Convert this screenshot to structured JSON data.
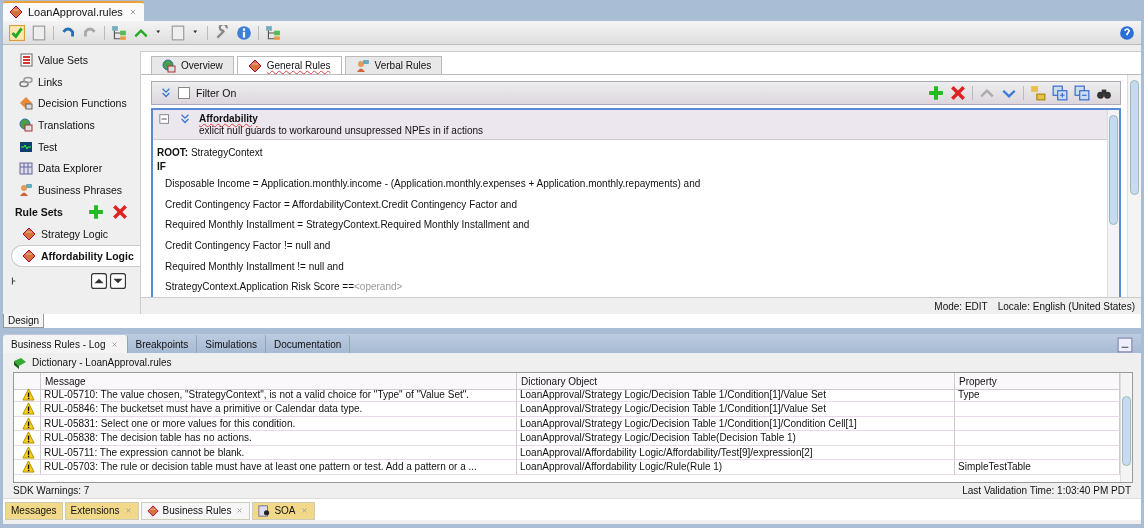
{
  "editor_tab": {
    "title": "LoanApproval.rules",
    "selected": true
  },
  "sidebar": {
    "items": [
      {
        "label": "Value Sets"
      },
      {
        "label": "Links"
      },
      {
        "label": "Decision Functions"
      },
      {
        "label": "Translations"
      },
      {
        "label": "Test"
      },
      {
        "label": "Data Explorer"
      },
      {
        "label": "Business Phrases"
      }
    ],
    "rule_sets_heading": "Rule Sets",
    "rule_sets": [
      {
        "label": "Strategy Logic",
        "selected": false
      },
      {
        "label": "Affordability Logic",
        "selected": true
      }
    ]
  },
  "content_tabs": [
    {
      "label": "Overview",
      "selected": false
    },
    {
      "label": "General Rules",
      "selected": true
    },
    {
      "label": "Verbal Rules",
      "selected": false
    }
  ],
  "filter": {
    "label": "Filter On",
    "checked": false
  },
  "rule": {
    "name": "Affordability",
    "description": "exlicit null guards to workaround unsupressed NPEs in if actions",
    "expanded": true,
    "root_label": "ROOT:",
    "root": "StrategyContext",
    "if_label": "IF",
    "conditions": [
      {
        "text": "Disposable Income = Application.monthly.income - (Application.monthly.expenses + Application.monthly.repayments) and"
      },
      {
        "text": "Credit Contingency Factor = AffordabilityContext.Credit Contingency Factor and"
      },
      {
        "text": "Required Monthly Installment = StrategyContext.Required Monthly Installment and"
      },
      {
        "text": "Credit Contingency Factor  !=  null and"
      },
      {
        "text": "Required Monthly Installment  !=  null and"
      },
      {
        "text": "StrategyContext.Application Risk Score  ==  ",
        "operand": "<operand>"
      }
    ]
  },
  "status": {
    "mode": "Mode: EDIT",
    "locale": "Locale: English (United States)"
  },
  "design_tab": {
    "label": "Design",
    "selected": true
  },
  "log_tabs": [
    {
      "label": "Business Rules - Log",
      "selected": true
    },
    {
      "label": "Breakpoints",
      "selected": false
    },
    {
      "label": "Simulations",
      "selected": false
    },
    {
      "label": "Documentation",
      "selected": false
    }
  ],
  "dictionary": "Dictionary - LoanApproval.rules",
  "log_table": {
    "columns": [
      "Message",
      "Dictionary Object",
      "Property"
    ],
    "rows": [
      {
        "message": "RUL-05710: The value chosen, \"StrategyContext\", is not a valid choice for \"Type\" of \"Value Set\".",
        "object": "LoanApproval/Strategy Logic/Decision Table 1/Condition[1]/Value Set",
        "property": "Type"
      },
      {
        "message": "RUL-05846: The bucketset must have a primitive or Calendar data type.",
        "object": "LoanApproval/Strategy Logic/Decision Table 1/Condition[1]/Value Set",
        "property": ""
      },
      {
        "message": "RUL-05831: Select one or more values for this condition.",
        "object": "LoanApproval/Strategy Logic/Decision Table 1/Condition[1]/Condition Cell[1]",
        "property": ""
      },
      {
        "message": "RUL-05838: The decision table has no actions.",
        "object": "LoanApproval/Strategy Logic/Decision Table(Decision Table 1)",
        "property": ""
      },
      {
        "message": "RUL-05711: The expression cannot be blank.",
        "object": "LoanApproval/Affordability Logic/Affordability/Test[9]/expression[2]",
        "property": ""
      },
      {
        "message": "RUL-05703: The rule or decision table must have at least one pattern or test.  Add a pattern or a ...",
        "object": "LoanApproval/Affordability Logic/Rule(Rule 1)",
        "property": "SimpleTestTable"
      }
    ]
  },
  "sdk_warnings": "SDK Warnings: 7",
  "last_validation": "Last Validation Time: 1:03:40 PM PDT",
  "window_tabs": [
    {
      "label": "Messages",
      "kind": "plain",
      "selected": false
    },
    {
      "label": "Extensions",
      "kind": "closable",
      "selected": false
    },
    {
      "label": "Business Rules",
      "kind": "closable",
      "selected": true
    },
    {
      "label": "SOA",
      "kind": "closable",
      "selected": false
    }
  ]
}
